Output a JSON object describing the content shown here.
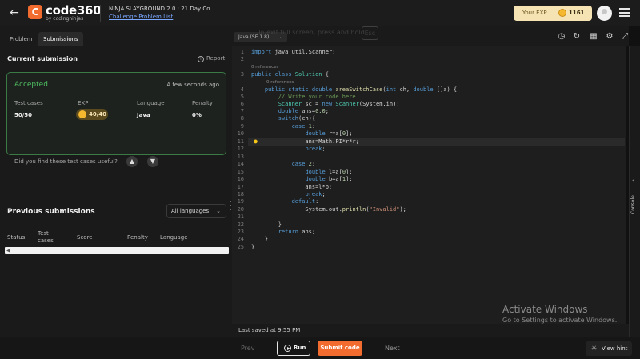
{
  "header": {
    "logo_text": "code360",
    "logo_sub": "by codingninjas",
    "contest_title": "NINJA SLAYGROUND 2.0 : 21 Day Co...",
    "problem_list_link": "Challenge Problem List",
    "exp_label": "Your EXP",
    "exp_value": "1161"
  },
  "left": {
    "tabs": [
      "Problem",
      "Submissions"
    ],
    "active_tab": "Submissions",
    "current_title": "Current submission",
    "report_label": "Report",
    "current": {
      "status": "Accepted",
      "time": "A few seconds ago",
      "labels": [
        "Test cases",
        "EXP",
        "Language",
        "Penalty"
      ],
      "test_cases": "50/50",
      "exp": "40/40",
      "language": "Java",
      "penalty": "0%",
      "useful_question": "Did you find these test cases useful?"
    },
    "previous_title": "Previous submissions",
    "language_filter": "All languages",
    "columns": [
      "Status",
      "Test cases",
      "Score",
      "Penalty",
      "Language"
    ]
  },
  "editor": {
    "language": "Java (SE 1.8)",
    "fullscreen_msg": "To exit full screen, press and hold",
    "esc_key": "Esc",
    "codelens": "0 references",
    "last_saved": "Last saved at 9:55 PM"
  },
  "watermark": {
    "line1": "Activate Windows",
    "line2": "Go to Settings to activate Windows."
  },
  "console_label": "Console",
  "bottom": {
    "prev": "Prev",
    "run": "Run",
    "submit": "Submit code",
    "next": "Next",
    "hint": "View hint"
  },
  "colors": {
    "accent": "#f26b2f",
    "accepted": "#4fbf63",
    "background": "#111111"
  }
}
